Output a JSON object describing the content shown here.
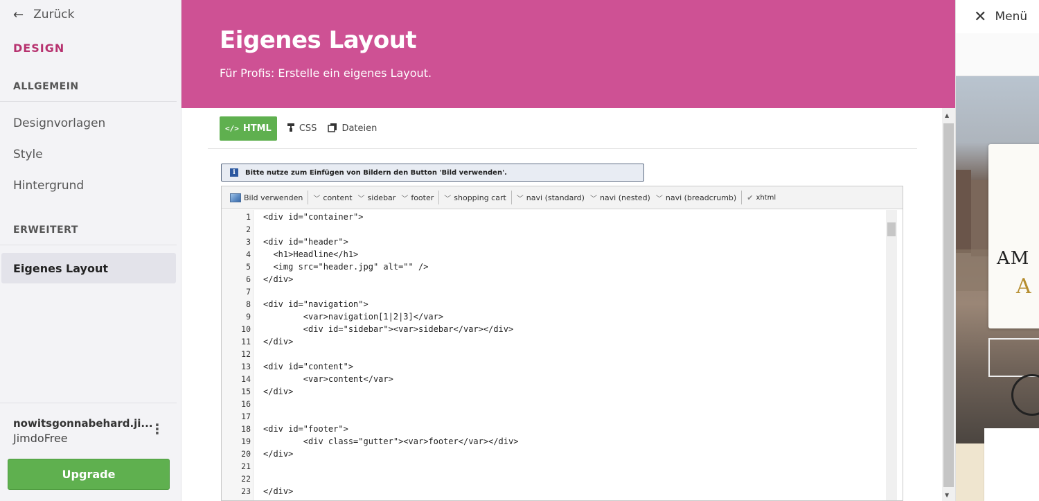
{
  "sidebar": {
    "back_label": "Zurück",
    "section_design": "DESIGN",
    "group_general": "ALLGEMEIN",
    "group_advanced": "ERWEITERT",
    "items": [
      {
        "label": "Designvorlagen"
      },
      {
        "label": "Style"
      },
      {
        "label": "Hintergrund"
      },
      {
        "label": "Eigenes Layout"
      }
    ],
    "site_name": "nowitsgonnabehard.ji...",
    "plan": "JimdoFree",
    "upgrade_label": "Upgrade"
  },
  "header": {
    "title": "Eigenes Layout",
    "subtitle": "Für Profis: Erstelle ein eigenes Layout."
  },
  "tabs": [
    {
      "label": "HTML",
      "icon": "code-icon",
      "active": true
    },
    {
      "label": "CSS",
      "icon": "paint-roller-icon",
      "active": false
    },
    {
      "label": "Dateien",
      "icon": "files-icon",
      "active": false
    }
  ],
  "info": {
    "text": "Bitte nutze zum Einfügen von Bildern den Button 'Bild verwenden'."
  },
  "toolbar": {
    "insert_image": "Bild verwenden",
    "content": "content",
    "sidebar": "sidebar",
    "footer": "footer",
    "shopping_cart": "shopping cart",
    "navi_standard": "navi (standard)",
    "navi_nested": "navi (nested)",
    "navi_breadcrumb": "navi (breadcrumb)",
    "xhtml": "xhtml"
  },
  "code_lines": [
    "<div id=\"container\">",
    "",
    "<div id=\"header\">",
    "  <h1>Headline</h1>",
    "  <img src=\"header.jpg\" alt=\"\" />",
    "</div>",
    "",
    "<div id=\"navigation\">",
    "        <var>navigation[1|2|3]</var>",
    "        <div id=\"sidebar\"><var>sidebar</var></div>",
    "</div>",
    "",
    "<div id=\"content\">",
    "        <var>content</var>",
    "</div>",
    "",
    "",
    "<div id=\"footer\">",
    "        <div class=\"gutter\"><var>footer</var></div>",
    "</div>",
    "",
    "",
    "</div>"
  ],
  "preview": {
    "menu_label": "Menü",
    "card_line1": "AM",
    "card_line2": "A"
  },
  "colors": {
    "brand_pink": "#ce5194",
    "design_label": "#b7326f",
    "success_green": "#5fb04f"
  }
}
